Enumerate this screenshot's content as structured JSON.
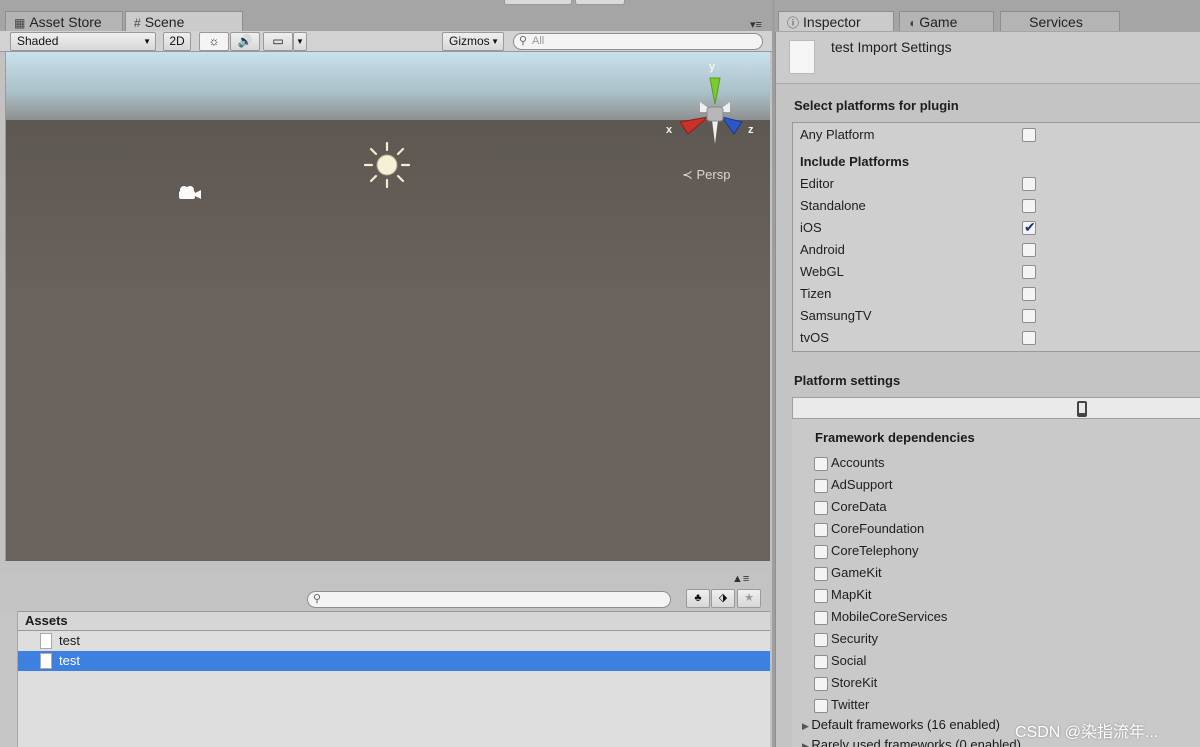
{
  "left_tabs": [
    {
      "icon": "cart-icon",
      "label": "Asset Store",
      "active": false
    },
    {
      "icon": "hash-icon",
      "label": "Scene",
      "active": true
    }
  ],
  "scene_toolbar": {
    "shading_mode": "Shaded",
    "mode_2d": "2D",
    "gizmos_label": "Gizmos",
    "search_placeholder": "All"
  },
  "viewport": {
    "projection_label": "Persp",
    "axis_x": "x",
    "axis_y": "y",
    "axis_z": "z"
  },
  "project": {
    "assets_header": "Assets",
    "assets": [
      {
        "name": "test",
        "selected": false
      },
      {
        "name": "test",
        "selected": true
      }
    ]
  },
  "right_tabs": [
    {
      "icon": "info-icon",
      "label": "Inspector",
      "active": true
    },
    {
      "icon": "pacman-icon",
      "label": "Game",
      "active": false
    },
    {
      "icon": "",
      "label": "Services",
      "active": false
    }
  ],
  "inspector": {
    "title": "test Import Settings",
    "select_platforms_title": "Select platforms for plugin",
    "any_platform": {
      "label": "Any Platform",
      "checked": false
    },
    "include_platforms_title": "Include Platforms",
    "platforms": [
      {
        "label": "Editor",
        "checked": false
      },
      {
        "label": "Standalone",
        "checked": false
      },
      {
        "label": "iOS",
        "checked": true
      },
      {
        "label": "Android",
        "checked": false
      },
      {
        "label": "WebGL",
        "checked": false
      },
      {
        "label": "Tizen",
        "checked": false
      },
      {
        "label": "SamsungTV",
        "checked": false
      },
      {
        "label": "tvOS",
        "checked": false
      }
    ],
    "platform_settings_title": "Platform settings",
    "framework_dependencies_title": "Framework dependencies",
    "frameworks": [
      {
        "label": "Accounts",
        "checked": false
      },
      {
        "label": "AdSupport",
        "checked": false
      },
      {
        "label": "CoreData",
        "checked": false
      },
      {
        "label": "CoreFoundation",
        "checked": false
      },
      {
        "label": "CoreTelephony",
        "checked": false
      },
      {
        "label": "GameKit",
        "checked": false
      },
      {
        "label": "MapKit",
        "checked": false
      },
      {
        "label": "MobileCoreServices",
        "checked": false
      },
      {
        "label": "Security",
        "checked": false
      },
      {
        "label": "Social",
        "checked": false
      },
      {
        "label": "StoreKit",
        "checked": false
      },
      {
        "label": "Twitter",
        "checked": false
      }
    ],
    "default_frameworks_label": "Default frameworks (16 enabled)",
    "rarely_used_frameworks_label": "Rarely used frameworks (0 enabled)"
  },
  "watermark": "CSDN @染指流年..."
}
